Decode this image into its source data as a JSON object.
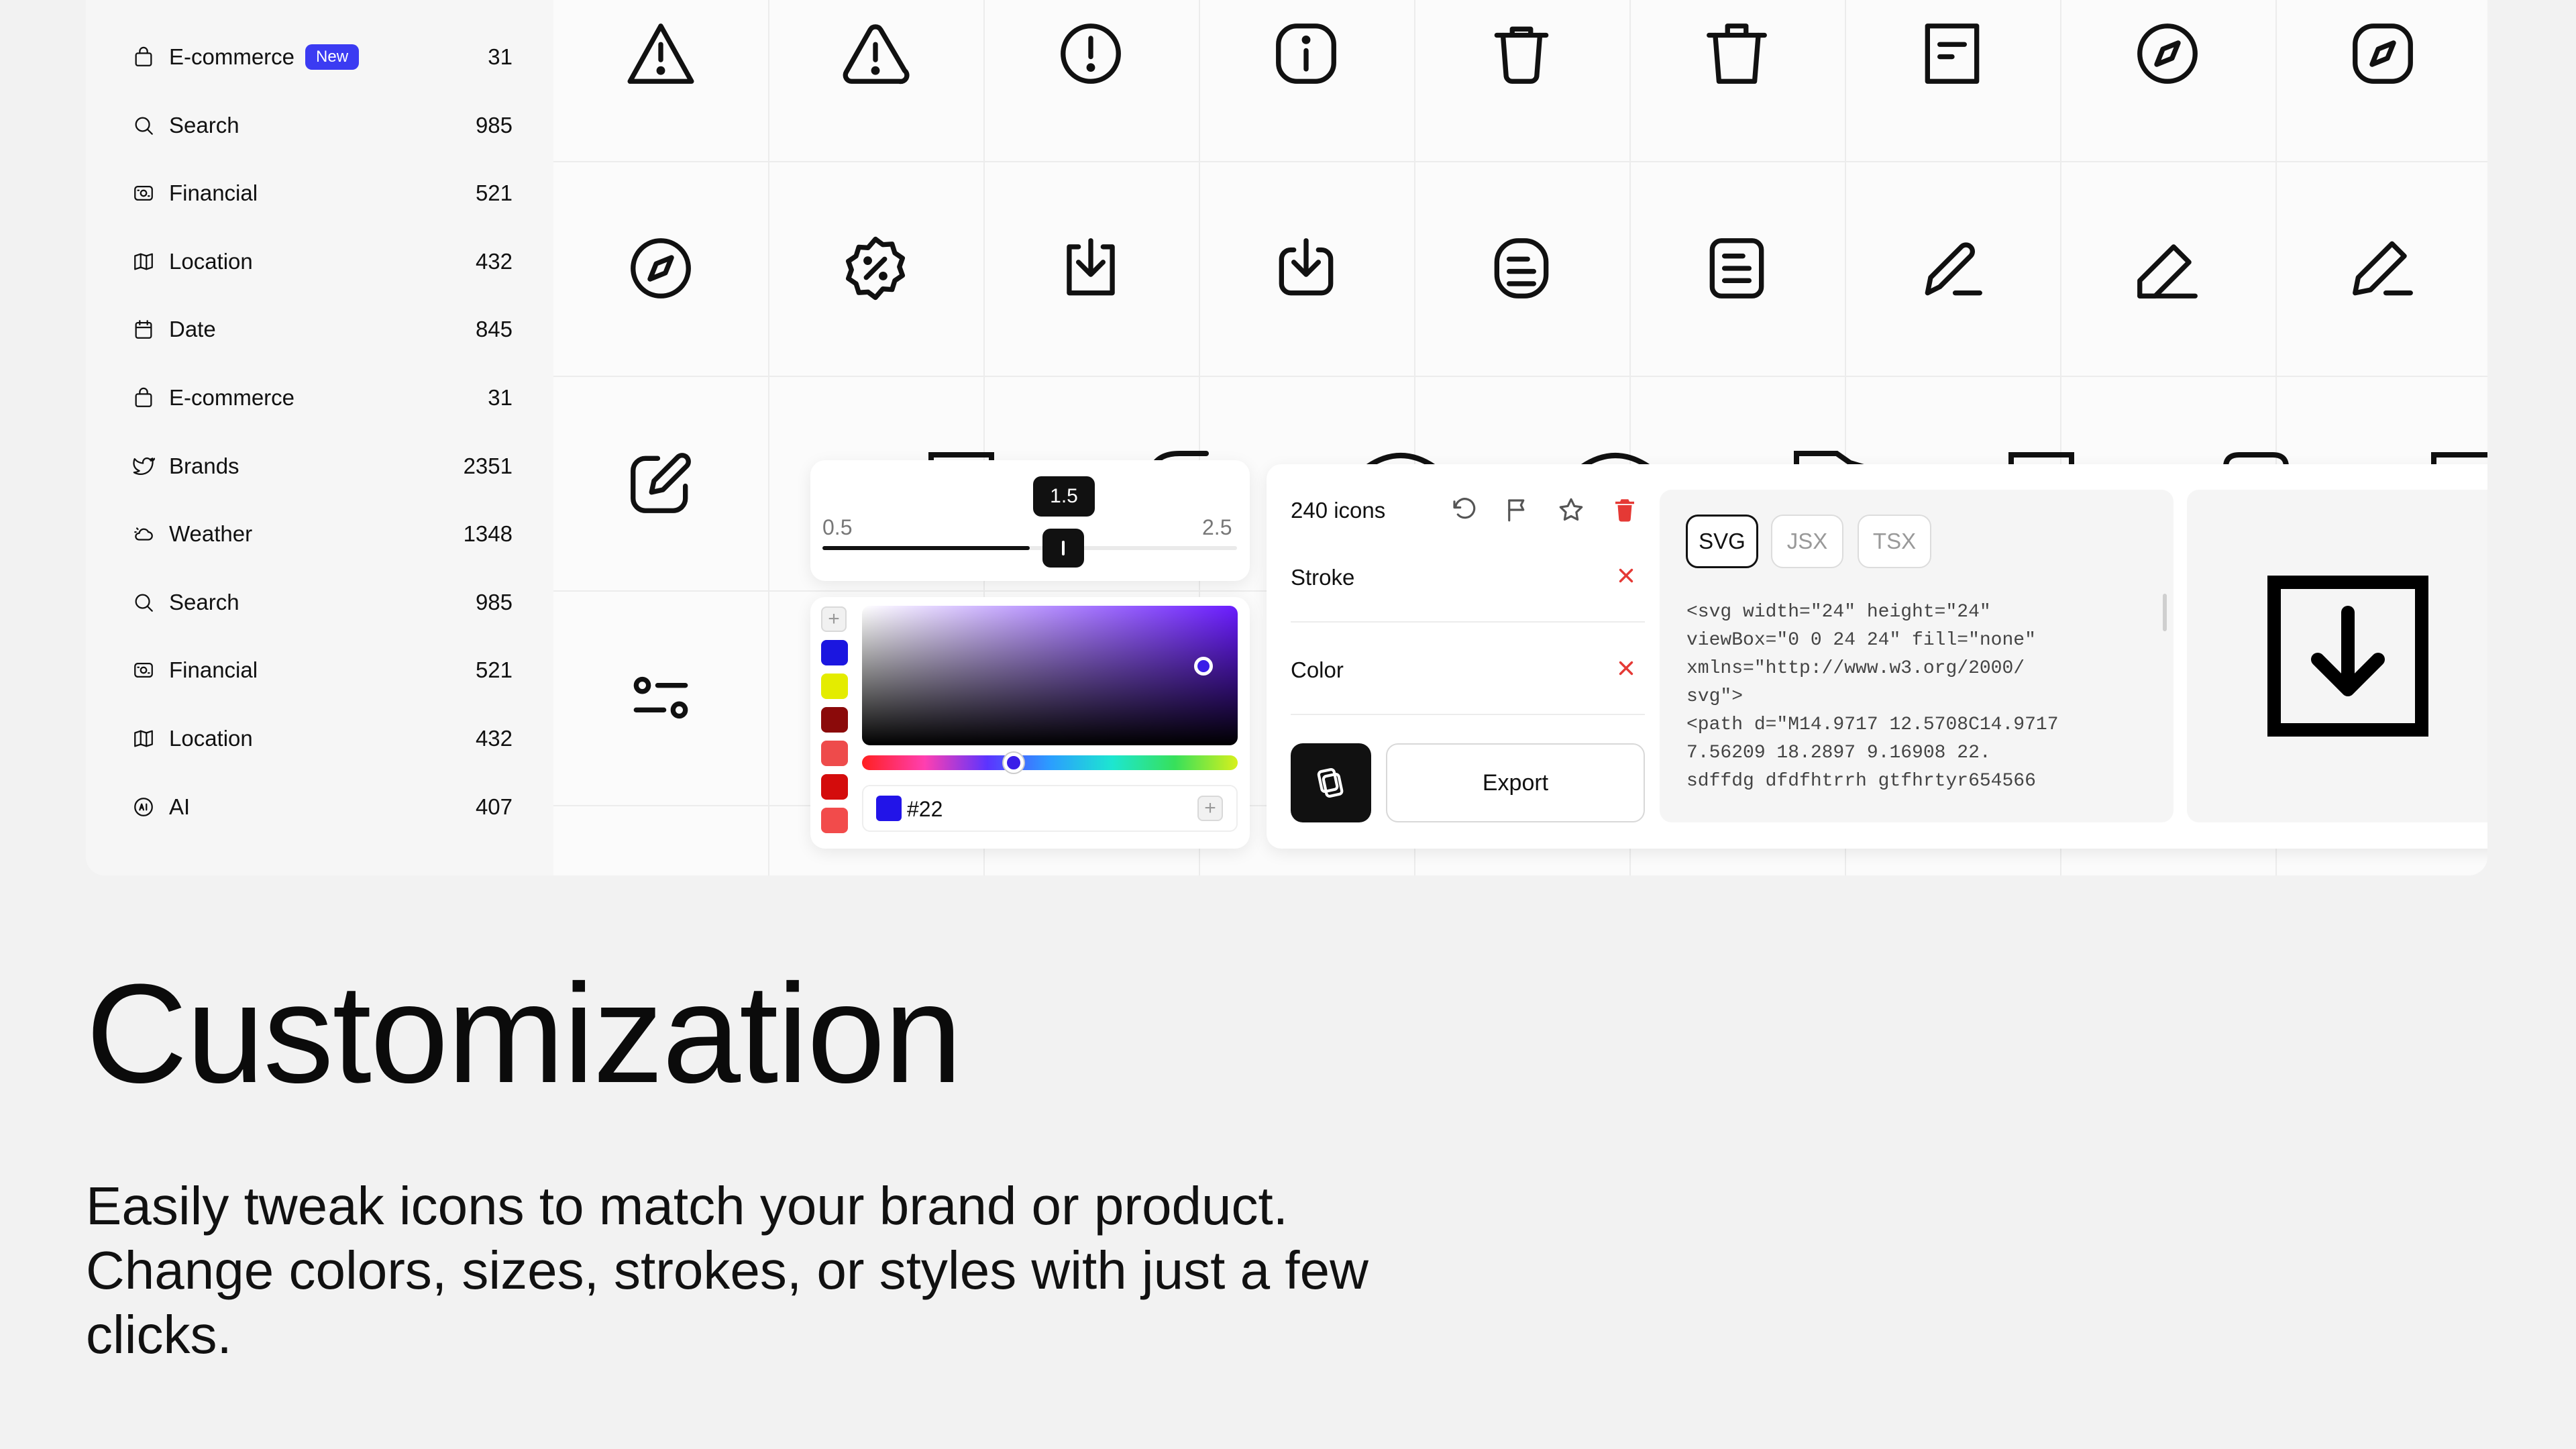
{
  "sidebar": {
    "items": [
      {
        "label": "E-commerce",
        "count": "31",
        "badge": "New",
        "icon": "shopping-bag-icon"
      },
      {
        "label": "Search",
        "count": "985",
        "icon": "search-icon"
      },
      {
        "label": "Financial",
        "count": "521",
        "icon": "money-icon"
      },
      {
        "label": "Location",
        "count": "432",
        "icon": "map-icon"
      },
      {
        "label": "Date",
        "count": "845",
        "icon": "calendar-icon"
      },
      {
        "label": "E-commerce",
        "count": "31",
        "icon": "shopping-bag-icon"
      },
      {
        "label": "Brands",
        "count": "2351",
        "icon": "twitter-bird-icon"
      },
      {
        "label": "Weather",
        "count": "1348",
        "icon": "cloud-sun-icon"
      },
      {
        "label": "Search",
        "count": "985",
        "icon": "search-icon"
      },
      {
        "label": "Financial",
        "count": "521",
        "icon": "money-icon"
      },
      {
        "label": "Location",
        "count": "432",
        "icon": "map-icon"
      },
      {
        "label": "AI",
        "count": "407",
        "icon": "ai-chip-icon"
      }
    ]
  },
  "icon_grid": {
    "rows": [
      [
        "alert-triangle-icon",
        "alert-triangle-rounded-icon",
        "alert-circle-icon",
        "info-square-icon",
        "trash-rounded-icon",
        "trash-icon",
        "document-icon",
        "compass-circle-icon",
        "compass-square-icon"
      ],
      [
        "compass-circle-icon",
        "discount-badge-icon",
        "download-square-icon",
        "download-rounded-icon",
        "notes-square-icon",
        "notes-rounded-icon",
        "pencil-line-icon",
        "pencil-square-line-icon",
        "pencil-sharp-line-icon"
      ],
      [
        "edit-box-icon"
      ],
      [
        "sliders-icon"
      ]
    ]
  },
  "stroke_slider": {
    "min": "0.5",
    "max": "2.5",
    "value": "1.5",
    "value_fraction": 0.5
  },
  "color_picker": {
    "swatches": [
      "#1b16e0",
      "#e4ec00",
      "#8b0a0a",
      "#ee4b4b",
      "#d40c0c",
      "#f24b4b"
    ],
    "hex_value": "#22",
    "selected_color": "#2214e8"
  },
  "export_panel": {
    "icon_count": "240 icons",
    "options": [
      "Stroke",
      "Color"
    ],
    "export_label": "Export",
    "formats": [
      "SVG",
      "JSX",
      "TSX"
    ],
    "active_format": "SVG",
    "code_lines": [
      "<svg width=\"24\" height=\"24\"",
      "viewBox=\"0 0 24 24\" fill=\"none\"",
      "xmlns=\"http://www.w3.org/2000/",
      "svg\">",
      "<path d=\"M14.9717 12.5708C14.9717",
      "7.56209 18.2897 9.16908 22.",
      "sdffdg dfdfhtrrh gtfhrtyr654566"
    ],
    "preview_icon": "download-square-icon"
  },
  "hero": {
    "title": "Customization",
    "description": "Easily tweak icons to match your brand or product. Change colors, sizes, strokes, or styles with just a few clicks."
  }
}
